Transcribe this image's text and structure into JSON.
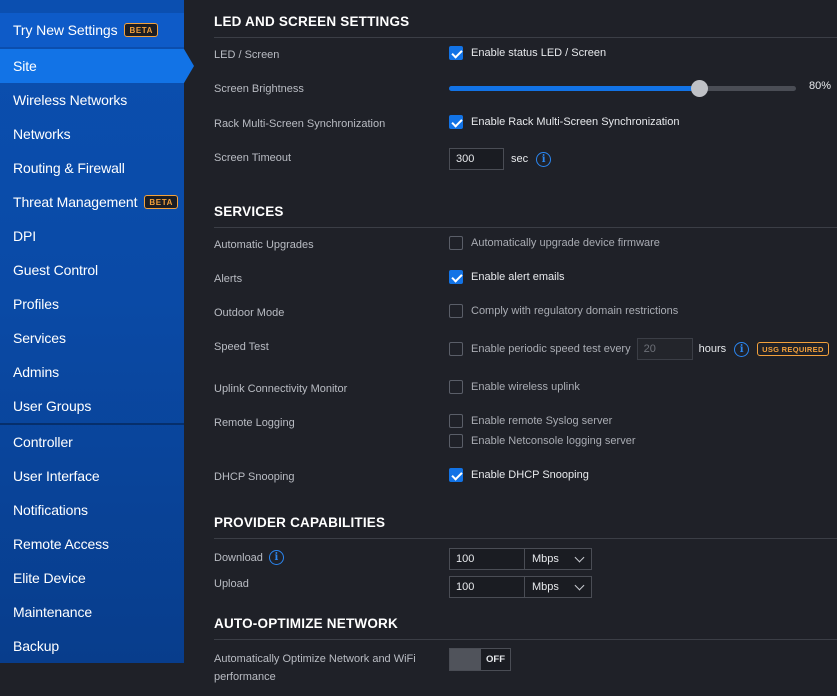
{
  "sidebar": {
    "try_new_settings": "Try New Settings",
    "beta_badge": "BETA",
    "items": [
      {
        "label": "Site"
      },
      {
        "label": "Wireless Networks"
      },
      {
        "label": "Networks"
      },
      {
        "label": "Routing & Firewall"
      },
      {
        "label": "Threat Management"
      },
      {
        "label": "DPI"
      },
      {
        "label": "Guest Control"
      },
      {
        "label": "Profiles"
      },
      {
        "label": "Services"
      },
      {
        "label": "Admins"
      },
      {
        "label": "User Groups"
      },
      {
        "label": "Controller"
      },
      {
        "label": "User Interface"
      },
      {
        "label": "Notifications"
      },
      {
        "label": "Remote Access"
      },
      {
        "label": "Elite Device"
      },
      {
        "label": "Maintenance"
      },
      {
        "label": "Backup"
      }
    ]
  },
  "led": {
    "title": "LED AND SCREEN SETTINGS",
    "led_screen_label": "LED / Screen",
    "led_screen_option": "Enable status LED / Screen",
    "brightness_label": "Screen Brightness",
    "brightness_value": "80%",
    "brightness_level": 0.8,
    "rack_label": "Rack Multi-Screen Synchronization",
    "rack_option": "Enable Rack Multi-Screen Synchronization",
    "timeout_label": "Screen Timeout",
    "timeout_value": "300",
    "timeout_unit": "sec"
  },
  "services": {
    "title": "SERVICES",
    "auto_upgrades_label": "Automatic Upgrades",
    "auto_upgrades_option": "Automatically upgrade device firmware",
    "alerts_label": "Alerts",
    "alerts_option": "Enable alert emails",
    "outdoor_label": "Outdoor Mode",
    "outdoor_option": "Comply with regulatory domain restrictions",
    "speed_label": "Speed Test",
    "speed_option": "Enable periodic speed test every",
    "speed_value": "20",
    "speed_unit": "hours",
    "usg_badge": "USG REQUIRED",
    "uplink_label": "Uplink Connectivity Monitor",
    "uplink_option": "Enable wireless uplink",
    "logging_label": "Remote Logging",
    "syslog_option": "Enable remote Syslog server",
    "netconsole_option": "Enable Netconsole logging server",
    "dhcp_label": "DHCP Snooping",
    "dhcp_option": "Enable DHCP Snooping"
  },
  "provider": {
    "title": "PROVIDER CAPABILITIES",
    "download_label": "Download",
    "download_value": "100",
    "download_unit": "Mbps",
    "upload_label": "Upload",
    "upload_value": "100",
    "upload_unit": "Mbps"
  },
  "optimize": {
    "title": "AUTO-OPTIMIZE NETWORK",
    "label_line1": "Automatically Optimize Network and WiFi",
    "label_line2": "performance",
    "toggle_state": "OFF"
  },
  "icons": {
    "info": "i"
  }
}
